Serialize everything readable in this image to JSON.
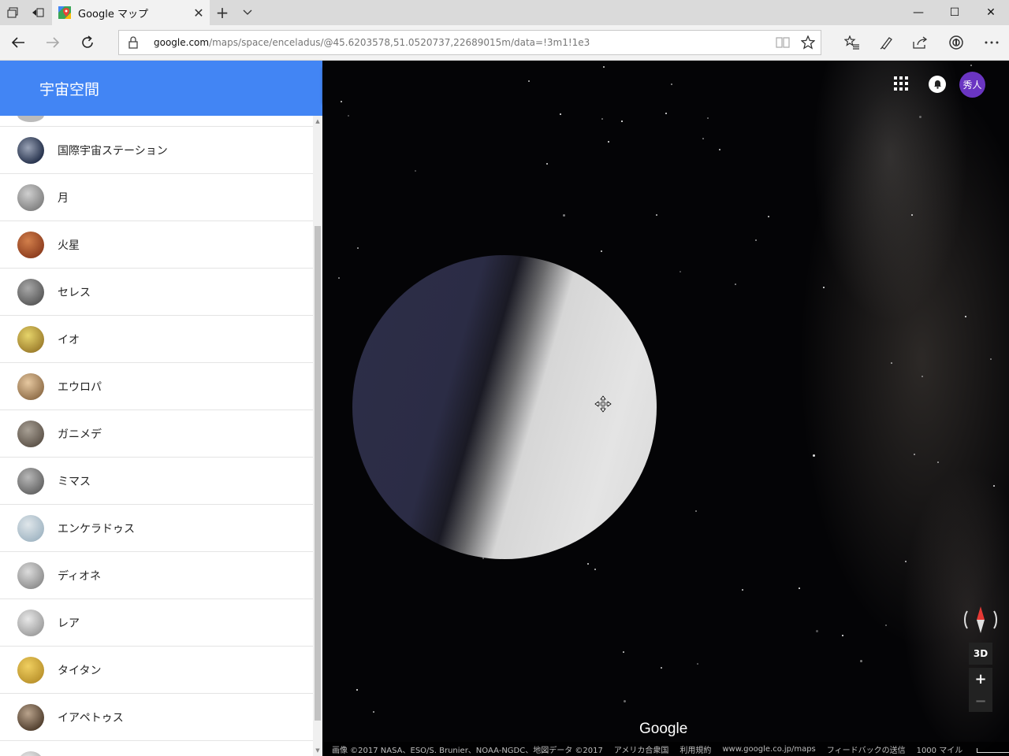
{
  "browser": {
    "tab_title": "Google マップ",
    "new_tab": "+",
    "tab_close": "✕",
    "url_domain": "google.com",
    "url_path": "/maps/space/enceladus/@45.6203578,51.0520737,22689015m/data=!3m1!1e3",
    "window": {
      "minimize": "—",
      "maximize": "☐",
      "close": "✕"
    }
  },
  "sidebar": {
    "title": "宇宙空間",
    "items": [
      {
        "label": "国際宇宙ステーション",
        "thumb": "iss"
      },
      {
        "label": "月",
        "thumb": "moon"
      },
      {
        "label": "火星",
        "thumb": "mars"
      },
      {
        "label": "セレス",
        "thumb": "ceres"
      },
      {
        "label": "イオ",
        "thumb": "io"
      },
      {
        "label": "エウロパ",
        "thumb": "europa"
      },
      {
        "label": "ガニメデ",
        "thumb": "ganymede"
      },
      {
        "label": "ミマス",
        "thumb": "mimas"
      },
      {
        "label": "エンケラドゥス",
        "thumb": "enceladus"
      },
      {
        "label": "ディオネ",
        "thumb": "dione"
      },
      {
        "label": "レア",
        "thumb": "rhea"
      },
      {
        "label": "タイタン",
        "thumb": "titan"
      },
      {
        "label": "イアペトゥス",
        "thumb": "iapetus"
      }
    ]
  },
  "map": {
    "avatar_label": "秀人",
    "btn_3d": "3D",
    "zoom_in": "+",
    "zoom_out": "−",
    "logo": "Google",
    "footer": {
      "attribution": "画像 ©2017 NASA、ESO/S. Brunier、NOAA-NGDC、地図データ ©2017",
      "region": "アメリカ合衆国",
      "terms": "利用規約",
      "site": "www.google.co.jp/maps",
      "feedback": "フィードバックの送信",
      "scale": "1000 マイル"
    }
  },
  "colors": {
    "header_blue": "#4285f4",
    "avatar_purple": "#6a35c2"
  }
}
